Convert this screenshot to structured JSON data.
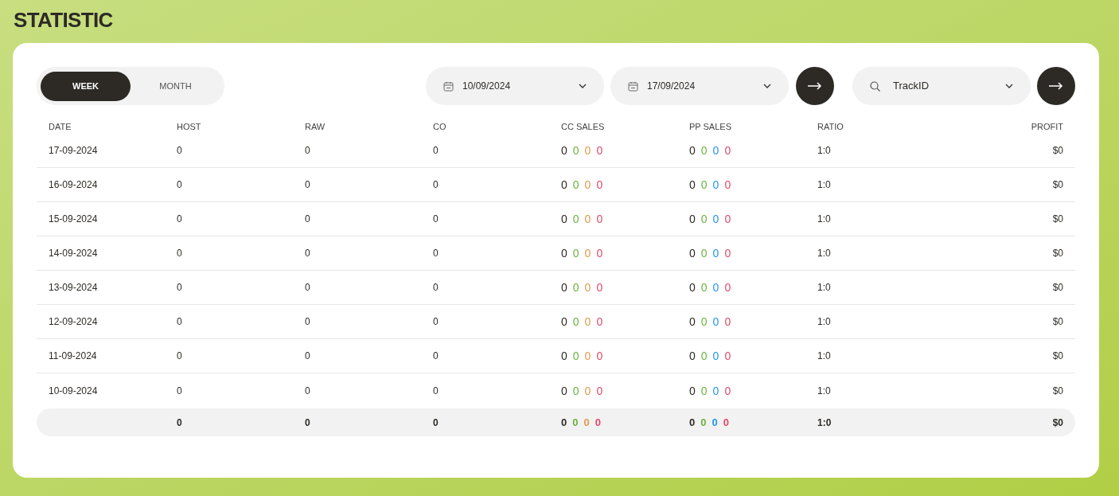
{
  "page_title": "STATISTIC",
  "period_tabs": [
    {
      "label": "WEEK",
      "selected": true
    },
    {
      "label": "MONTH",
      "selected": false
    }
  ],
  "date_from": {
    "value": "10/09/2024"
  },
  "date_to": {
    "value": "17/09/2024"
  },
  "tracking_select": {
    "value": "TrackID"
  },
  "table": {
    "columns": [
      "DATE",
      "HOST",
      "RAW",
      "CO",
      "CC SALES",
      "PP SALES",
      "RATIO",
      "PROFIT"
    ],
    "rows": [
      {
        "date": "17-09-2024",
        "host": "0",
        "raw": "0",
        "co": "0",
        "cc_sales": [
          {
            "value": "0",
            "color": "#2d2a26"
          },
          {
            "value": "0",
            "color": "#6cb33f"
          },
          {
            "value": "0",
            "color": "#e39a4c"
          },
          {
            "value": "0",
            "color": "#e04a6a"
          }
        ],
        "pp_sales": [
          {
            "value": "0",
            "color": "#2d2a26"
          },
          {
            "value": "0",
            "color": "#6cb33f"
          },
          {
            "value": "0",
            "color": "#2196f3"
          },
          {
            "value": "0",
            "color": "#e04a6a"
          }
        ],
        "ratio": "1:0",
        "profit": "$0"
      },
      {
        "date": "16-09-2024",
        "host": "0",
        "raw": "0",
        "co": "0",
        "cc_sales": [
          {
            "value": "0",
            "color": "#2d2a26"
          },
          {
            "value": "0",
            "color": "#6cb33f"
          },
          {
            "value": "0",
            "color": "#e39a4c"
          },
          {
            "value": "0",
            "color": "#e04a6a"
          }
        ],
        "pp_sales": [
          {
            "value": "0",
            "color": "#2d2a26"
          },
          {
            "value": "0",
            "color": "#6cb33f"
          },
          {
            "value": "0",
            "color": "#2196f3"
          },
          {
            "value": "0",
            "color": "#e04a6a"
          }
        ],
        "ratio": "1:0",
        "profit": "$0"
      },
      {
        "date": "15-09-2024",
        "host": "0",
        "raw": "0",
        "co": "0",
        "cc_sales": [
          {
            "value": "0",
            "color": "#2d2a26"
          },
          {
            "value": "0",
            "color": "#6cb33f"
          },
          {
            "value": "0",
            "color": "#e39a4c"
          },
          {
            "value": "0",
            "color": "#e04a6a"
          }
        ],
        "pp_sales": [
          {
            "value": "0",
            "color": "#2d2a26"
          },
          {
            "value": "0",
            "color": "#6cb33f"
          },
          {
            "value": "0",
            "color": "#2196f3"
          },
          {
            "value": "0",
            "color": "#e04a6a"
          }
        ],
        "ratio": "1:0",
        "profit": "$0"
      },
      {
        "date": "14-09-2024",
        "host": "0",
        "raw": "0",
        "co": "0",
        "cc_sales": [
          {
            "value": "0",
            "color": "#2d2a26"
          },
          {
            "value": "0",
            "color": "#6cb33f"
          },
          {
            "value": "0",
            "color": "#e39a4c"
          },
          {
            "value": "0",
            "color": "#e04a6a"
          }
        ],
        "pp_sales": [
          {
            "value": "0",
            "color": "#2d2a26"
          },
          {
            "value": "0",
            "color": "#6cb33f"
          },
          {
            "value": "0",
            "color": "#2196f3"
          },
          {
            "value": "0",
            "color": "#e04a6a"
          }
        ],
        "ratio": "1:0",
        "profit": "$0"
      },
      {
        "date": "13-09-2024",
        "host": "0",
        "raw": "0",
        "co": "0",
        "cc_sales": [
          {
            "value": "0",
            "color": "#2d2a26"
          },
          {
            "value": "0",
            "color": "#6cb33f"
          },
          {
            "value": "0",
            "color": "#e39a4c"
          },
          {
            "value": "0",
            "color": "#e04a6a"
          }
        ],
        "pp_sales": [
          {
            "value": "0",
            "color": "#2d2a26"
          },
          {
            "value": "0",
            "color": "#6cb33f"
          },
          {
            "value": "0",
            "color": "#2196f3"
          },
          {
            "value": "0",
            "color": "#e04a6a"
          }
        ],
        "ratio": "1:0",
        "profit": "$0"
      },
      {
        "date": "12-09-2024",
        "host": "0",
        "raw": "0",
        "co": "0",
        "cc_sales": [
          {
            "value": "0",
            "color": "#2d2a26"
          },
          {
            "value": "0",
            "color": "#6cb33f"
          },
          {
            "value": "0",
            "color": "#e39a4c"
          },
          {
            "value": "0",
            "color": "#e04a6a"
          }
        ],
        "pp_sales": [
          {
            "value": "0",
            "color": "#2d2a26"
          },
          {
            "value": "0",
            "color": "#6cb33f"
          },
          {
            "value": "0",
            "color": "#2196f3"
          },
          {
            "value": "0",
            "color": "#e04a6a"
          }
        ],
        "ratio": "1:0",
        "profit": "$0"
      },
      {
        "date": "11-09-2024",
        "host": "0",
        "raw": "0",
        "co": "0",
        "cc_sales": [
          {
            "value": "0",
            "color": "#2d2a26"
          },
          {
            "value": "0",
            "color": "#6cb33f"
          },
          {
            "value": "0",
            "color": "#e39a4c"
          },
          {
            "value": "0",
            "color": "#e04a6a"
          }
        ],
        "pp_sales": [
          {
            "value": "0",
            "color": "#2d2a26"
          },
          {
            "value": "0",
            "color": "#6cb33f"
          },
          {
            "value": "0",
            "color": "#2196f3"
          },
          {
            "value": "0",
            "color": "#e04a6a"
          }
        ],
        "ratio": "1:0",
        "profit": "$0"
      },
      {
        "date": "10-09-2024",
        "host": "0",
        "raw": "0",
        "co": "0",
        "cc_sales": [
          {
            "value": "0",
            "color": "#2d2a26"
          },
          {
            "value": "0",
            "color": "#6cb33f"
          },
          {
            "value": "0",
            "color": "#e39a4c"
          },
          {
            "value": "0",
            "color": "#e04a6a"
          }
        ],
        "pp_sales": [
          {
            "value": "0",
            "color": "#2d2a26"
          },
          {
            "value": "0",
            "color": "#6cb33f"
          },
          {
            "value": "0",
            "color": "#2196f3"
          },
          {
            "value": "0",
            "color": "#e04a6a"
          }
        ],
        "ratio": "1:0",
        "profit": "$0"
      }
    ],
    "totals": {
      "host": "0",
      "raw": "0",
      "co": "0",
      "cc_sales": [
        {
          "value": "0",
          "color": "#2d2a26"
        },
        {
          "value": "0",
          "color": "#6cb33f"
        },
        {
          "value": "0",
          "color": "#e39a4c"
        },
        {
          "value": "0",
          "color": "#e04a6a"
        }
      ],
      "pp_sales": [
        {
          "value": "0",
          "color": "#2d2a26"
        },
        {
          "value": "0",
          "color": "#6cb33f"
        },
        {
          "value": "0",
          "color": "#2196f3"
        },
        {
          "value": "0",
          "color": "#e04a6a"
        }
      ],
      "ratio": "1:0",
      "profit": "$0"
    }
  }
}
